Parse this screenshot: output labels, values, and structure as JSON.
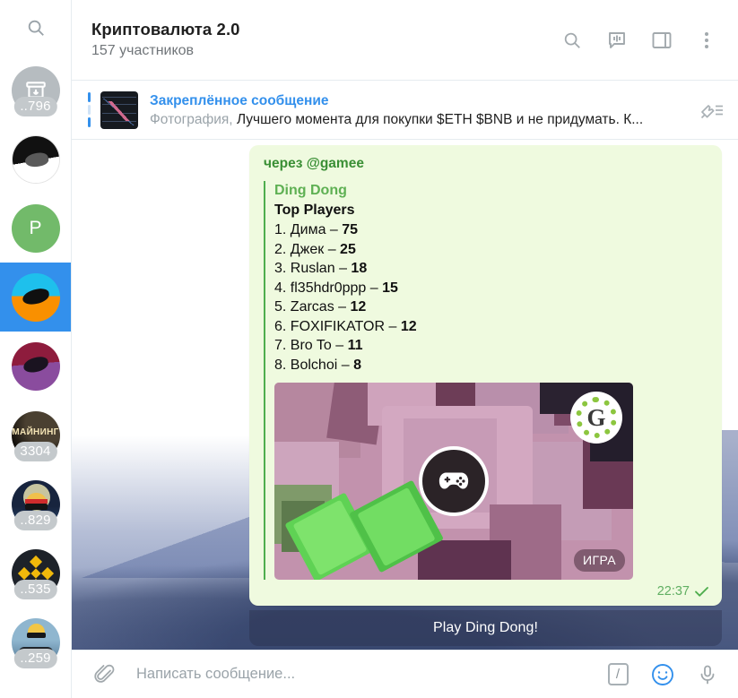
{
  "sidebar": {
    "search_icon": "search-icon",
    "items": [
      {
        "name": "archived-chats",
        "badge": "..796",
        "type": "archive"
      },
      {
        "name": "chat-bw",
        "badge": "",
        "type": "bw"
      },
      {
        "name": "chat-p",
        "badge": "",
        "type": "letter",
        "letter": "P"
      },
      {
        "name": "chat-selected",
        "badge": "",
        "type": "cyan",
        "selected": true
      },
      {
        "name": "chat-purple",
        "badge": "",
        "type": "purple"
      },
      {
        "name": "chat-mining",
        "badge": "3304",
        "type": "mining",
        "label": "МАЙНИНГ"
      },
      {
        "name": "chat-moon",
        "badge": "..829",
        "type": "moon"
      },
      {
        "name": "chat-binance",
        "badge": "..535",
        "type": "binance"
      },
      {
        "name": "chat-suit",
        "badge": "..259",
        "type": "suit"
      }
    ]
  },
  "header": {
    "title": "Криптовалюта 2.0",
    "subtitle": "157 участников",
    "icons": [
      "search-icon",
      "voice-chat-icon",
      "sidebar-toggle-icon",
      "more-menu-icon"
    ]
  },
  "pinned": {
    "label": "Закреплённое сообщение",
    "kind": "Фотография,",
    "preview": "Лучшего момента для покупки $ETH $BNB и не придумать. К...",
    "icon": "pin-list-icon"
  },
  "message": {
    "via": "через @gamee",
    "webpage": {
      "site": "Ding Dong",
      "title": "Top Players",
      "rows": [
        {
          "rank": "1.",
          "player": "Дима",
          "dash": "–",
          "score": "75"
        },
        {
          "rank": "2.",
          "player": "Джек",
          "dash": "–",
          "score": "25"
        },
        {
          "rank": "3.",
          "player": "Ruslan",
          "dash": "–",
          "score": "18"
        },
        {
          "rank": "4.",
          "player": "fl35hdr0ppp",
          "dash": "–",
          "score": "15"
        },
        {
          "rank": "5.",
          "player": "Zarcas",
          "dash": "–",
          "score": "12"
        },
        {
          "rank": "6.",
          "player": "FOXIFIKATOR",
          "dash": "–",
          "score": "12"
        },
        {
          "rank": "7.",
          "player": "Bro To",
          "dash": "–",
          "score": "11"
        },
        {
          "rank": "8.",
          "player": "Bolchoi",
          "dash": "–",
          "score": "8"
        }
      ],
      "game_badge_letter": "G",
      "game_label": "ИГРА",
      "play_icon": "gamepad-icon"
    },
    "time": "22:37",
    "status_icon": "sent-check-icon",
    "button_label": "Play Ding Dong!"
  },
  "composer": {
    "attach_icon": "paperclip-icon",
    "placeholder": "Написать сообщение...",
    "value": "",
    "slash_label": "/",
    "icons": [
      "slash-command-icon",
      "emoji-icon",
      "microphone-icon"
    ]
  },
  "colors": {
    "accent": "#3390ec",
    "bubble_bg": "#effadf",
    "site_green": "#5eb053",
    "via_green": "#3a8f35",
    "time_green": "#61af63",
    "badge_green": "#8cc63f"
  }
}
